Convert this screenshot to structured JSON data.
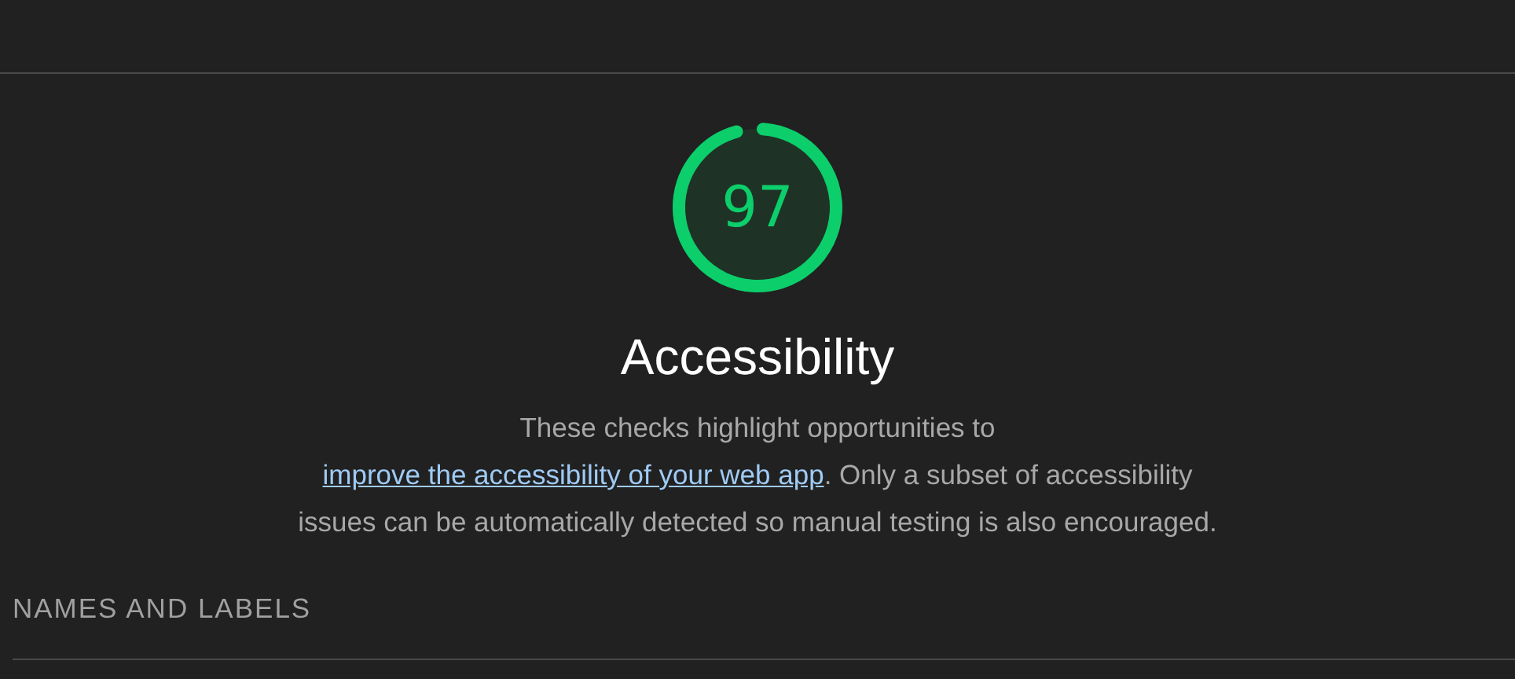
{
  "category": {
    "score": "97",
    "level": 0.97,
    "title": "Accessibility",
    "description": {
      "before": "These checks highlight opportunities to ",
      "link": "improve the accessibility of your web app",
      "after": ". Only a subset of accessibility issues can be automatically detected so manual testing is also encouraged."
    }
  },
  "groups": [
    {
      "title": "NAMES AND LABELS"
    }
  ]
}
